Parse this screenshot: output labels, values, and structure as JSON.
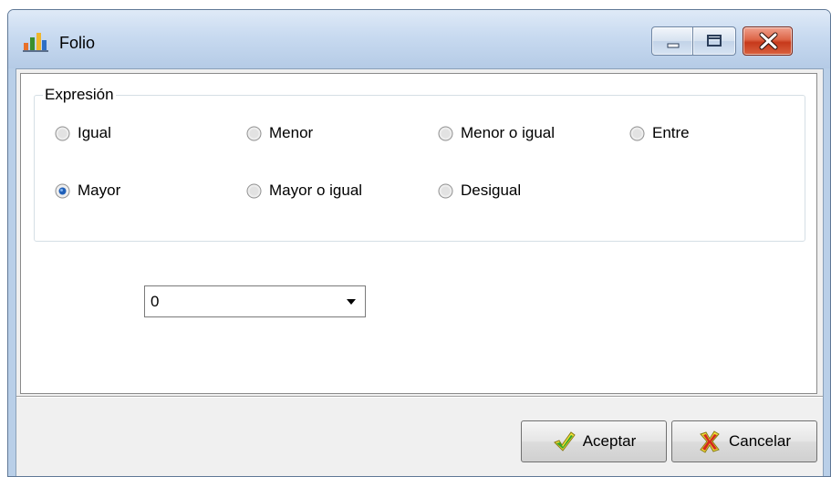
{
  "window": {
    "title": "Folio",
    "app_icon": "chart-icon",
    "controls": {
      "minimize_icon": "minimize-icon",
      "maximize_icon": "maximize-icon",
      "close_icon": "close-icon"
    }
  },
  "expression_group": {
    "legend": "Expresión",
    "selected": "Mayor",
    "options": [
      {
        "label": "Igual",
        "checked": false
      },
      {
        "label": "Menor",
        "checked": false
      },
      {
        "label": "Menor o igual",
        "checked": false
      },
      {
        "label": "Entre",
        "checked": false
      },
      {
        "label": "Mayor",
        "checked": true
      },
      {
        "label": "Mayor o igual",
        "checked": false
      },
      {
        "label": "Desigual",
        "checked": false
      }
    ]
  },
  "value_combo": {
    "value": "0",
    "arrow_icon": "dropdown-arrow-icon"
  },
  "buttons": {
    "accept": {
      "label": "Aceptar",
      "icon": "green-check-icon"
    },
    "cancel": {
      "label": "Cancelar",
      "icon": "red-x-icon"
    }
  },
  "colors": {
    "title_bar": "#c8daf0",
    "close_button": "#c7391b",
    "radio_selected": "#1f5fb8"
  }
}
